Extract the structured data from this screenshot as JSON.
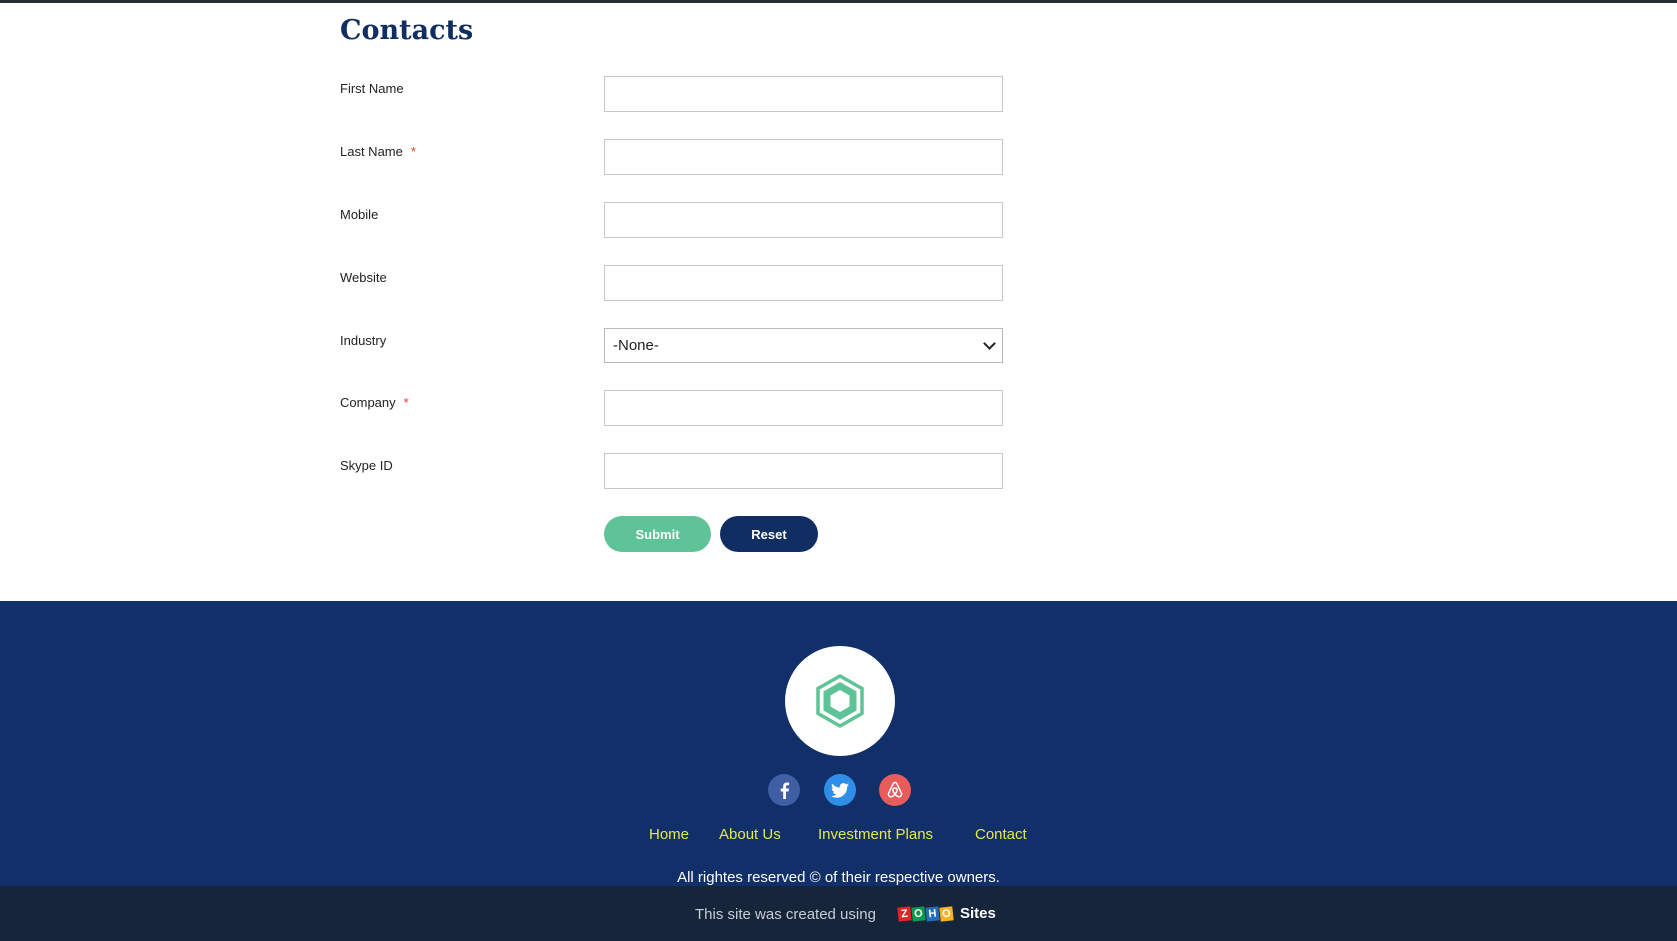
{
  "form": {
    "title": "Contacts",
    "required_mark": "*",
    "fields": {
      "first_name": {
        "label": "First Name",
        "value": "",
        "required": false
      },
      "last_name": {
        "label": "Last Name",
        "value": "",
        "required": true
      },
      "mobile": {
        "label": "Mobile",
        "value": "",
        "required": false
      },
      "website": {
        "label": "Website",
        "value": "",
        "required": false
      },
      "industry": {
        "label": "Industry",
        "selected": "-None-",
        "required": false
      },
      "company": {
        "label": "Company",
        "value": "",
        "required": true
      },
      "skype_id": {
        "label": "Skype ID",
        "value": "",
        "required": false
      }
    },
    "submit_label": "Submit",
    "reset_label": "Reset"
  },
  "footer": {
    "logo_icon": "hexagon-logo-icon",
    "social": [
      {
        "name": "facebook-icon",
        "color": "#3f5ea3"
      },
      {
        "name": "twitter-icon",
        "color": "#2f8ee8"
      },
      {
        "name": "airbnb-icon",
        "color": "#e85c5b"
      }
    ],
    "nav": [
      "Home",
      "About Us",
      "Investment Plans",
      "Contact"
    ],
    "copyright": "All rightes reserved © of their respective owners."
  },
  "bottom_bar": {
    "created_text": "This site was created using",
    "brand_letters": [
      "Z",
      "O",
      "H",
      "O"
    ],
    "brand_product": "Sites"
  },
  "colors": {
    "primary_navy": "#112e63",
    "accent_green": "#5ec396",
    "nav_link": "#e6e84a",
    "required": "#e33b2e"
  }
}
